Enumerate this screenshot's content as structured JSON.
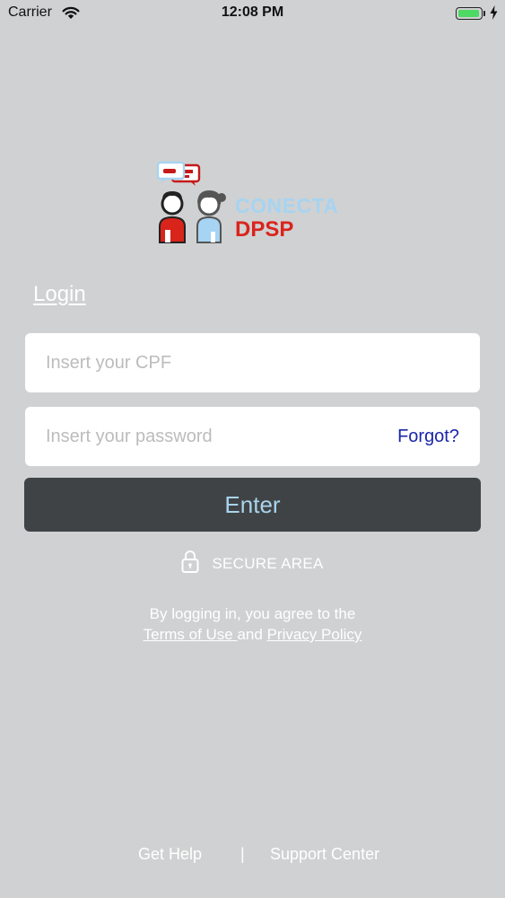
{
  "status_bar": {
    "carrier": "Carrier",
    "time": "12:08 PM",
    "battery_level": 1.0
  },
  "logo": {
    "line1": "CONECTA",
    "line2": "DPSP"
  },
  "login": {
    "title": "Login",
    "cpf_placeholder": "Insert your CPF",
    "password_placeholder": "Insert your password",
    "forgot_label": "Forgot?",
    "enter_label": "Enter",
    "secure_label": "SECURE AREA"
  },
  "terms": {
    "prefix": "By logging in, you agree to the",
    "terms_link": "Terms of Use ",
    "conjunction": "and",
    "privacy_link": "Privacy Policy"
  },
  "footer": {
    "help": "Get Help",
    "separator": "|",
    "support": "Support Center"
  },
  "colors": {
    "background": "#d0d1d2",
    "button": "#3f4346",
    "button_text": "#a9d3ec",
    "link": "#1c27a8",
    "brand_red": "#d9241c",
    "brand_blue": "#a6d4f2"
  },
  "icons": [
    "wifi-icon",
    "battery-icon",
    "charging-bolt-icon",
    "lock-icon",
    "logo-icon"
  ]
}
